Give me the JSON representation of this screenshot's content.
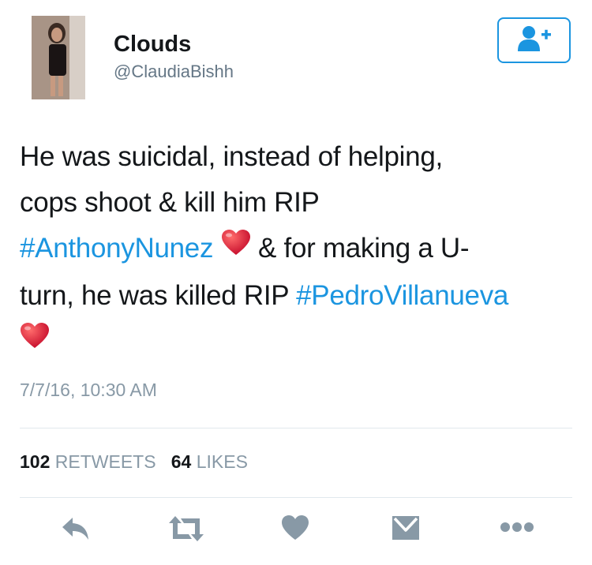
{
  "user": {
    "display_name": "Clouds",
    "handle": "@ClaudiaBishh"
  },
  "follow_button": {
    "icon": "add-user-icon",
    "color": "#1b95e0"
  },
  "tweet": {
    "line1": "He was suicidal, instead of helping,",
    "line2": "cops shoot & kill him RIP",
    "hashtag1": "#AnthonyNunez",
    "line3_rest": "& for making a U-",
    "line4": "turn, he was killed RIP",
    "hashtag2": "#PedroVillanueva",
    "emoji": "heart-emoji"
  },
  "timestamp": "7/7/16, 10:30 AM",
  "stats": {
    "retweets_count": "102",
    "retweets_label": "RETWEETS",
    "likes_count": "64",
    "likes_label": "LIKES"
  },
  "actions": [
    "reply-icon",
    "retweet-icon",
    "like-icon",
    "direct-message-icon",
    "more-icon"
  ],
  "colors": {
    "link": "#1b95e0",
    "secondary": "#8899a6",
    "text": "#14171a",
    "icon": "#8899a6"
  }
}
